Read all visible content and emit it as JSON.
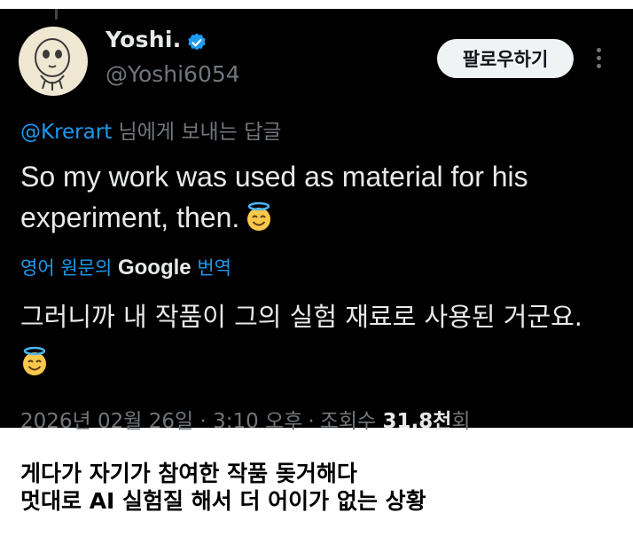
{
  "tweet": {
    "author_name": "Yoshi.",
    "author_handle": "@Yoshi6054",
    "follow_label": "팔로우하기",
    "reply_to_handle": "@Krerart",
    "reply_to_suffix": "님에게 보내는 답글",
    "text": "So my work was used as material for his experiment, then.",
    "translate_prefix": "영어 원문의",
    "translate_brand": "Google",
    "translate_suffix": "번역",
    "translated_text": "그러니까 내 작품이 그의 실험 재료로 사용된 거군요.",
    "timestamp": "2026년 02월 26일 · 3:10 오후",
    "views_prefix": "조회수",
    "views_count": "31.8천",
    "views_suffix": "회",
    "emoji_icon": "smiling-face-with-halo"
  },
  "caption": {
    "line1": "게다가 자기가 참여한 작품 돚거해다",
    "line2": "멋대로 AI 실험질 해서 더 어이가 없는 상황"
  },
  "colors": {
    "background": "#000000",
    "text_primary": "#e7e9ea",
    "text_secondary": "#71767b",
    "accent": "#1d9bf0",
    "follow_button_bg": "#eff3f4"
  }
}
